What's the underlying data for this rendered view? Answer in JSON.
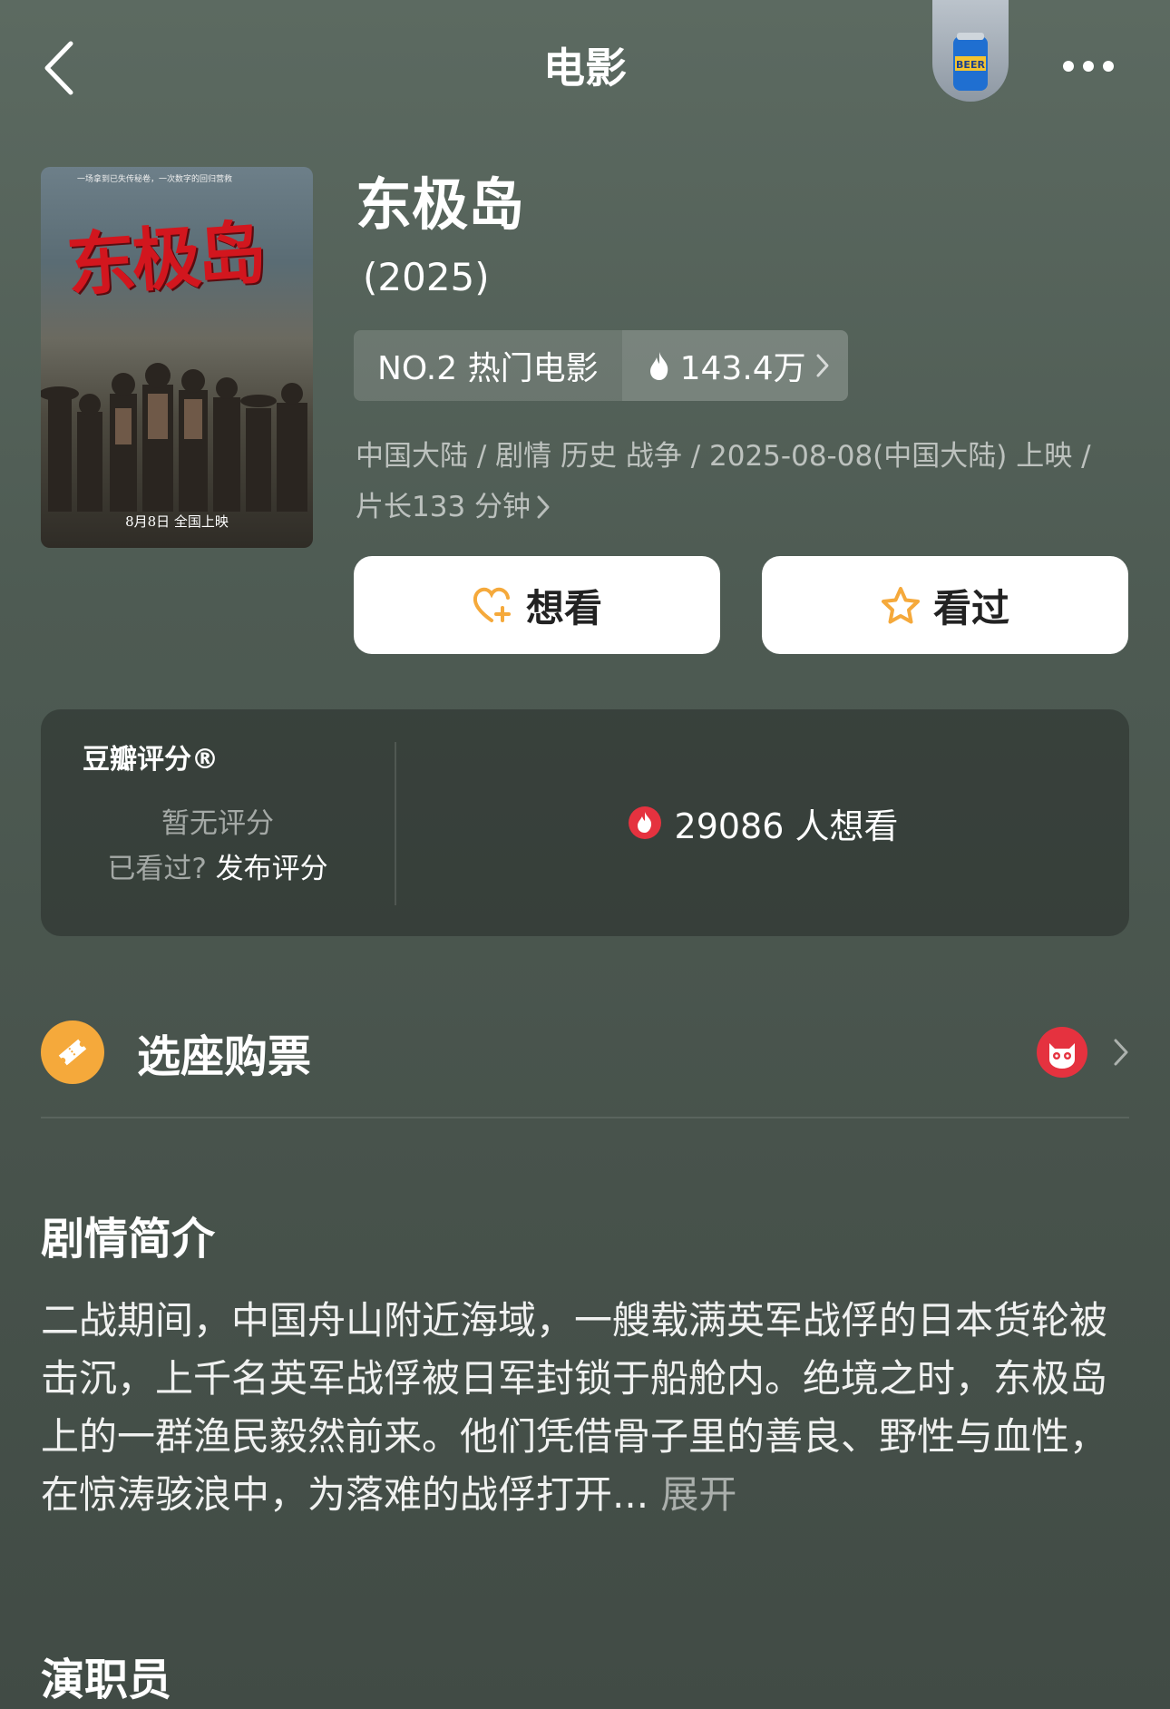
{
  "header": {
    "title": "电影",
    "back_icon": "chevron-left-icon",
    "more_icon": "more-dots-icon",
    "can_label": "BEER"
  },
  "movie": {
    "title": "东极岛",
    "year": "(2025)",
    "rank_label": "NO.2 热门电影",
    "heat_value": "143.4万",
    "meta_line1": "中国大陆 / 剧情 历史 战争 / 2025-08-08(中国大陆) 上映 /",
    "meta_line2": "片长133 分钟",
    "poster": {
      "title_text": "东极岛",
      "tagline": "一场拿到已失传秘卷，一次数字的回归营救",
      "release": "8月8日 全国上映"
    }
  },
  "actions": {
    "want_label": "想看",
    "seen_label": "看过"
  },
  "rating": {
    "label": "豆瓣评分®",
    "no_rating": "暂无评分",
    "seen_question": "已看过?",
    "rate_link": "发布评分",
    "want_count": "29086 人想看"
  },
  "ticket": {
    "label": "选座购票"
  },
  "synopsis": {
    "heading": "剧情简介",
    "text": "二战期间，中国舟山附近海域，一艘载满英军战俘的日本货轮被击沉，上千名英军战俘被日军封锁于船舱内。绝境之时，东极岛上的一群渔民毅然前来。他们凭借骨子里的善良、野性与血性，在惊涛骇浪中，为落难的战俘打开...",
    "more": "展开"
  },
  "cast": {
    "heading": "演职员"
  },
  "colors": {
    "accent_orange": "#f5a93b",
    "hot_red": "#e5323f",
    "background": "#4e5b53"
  }
}
